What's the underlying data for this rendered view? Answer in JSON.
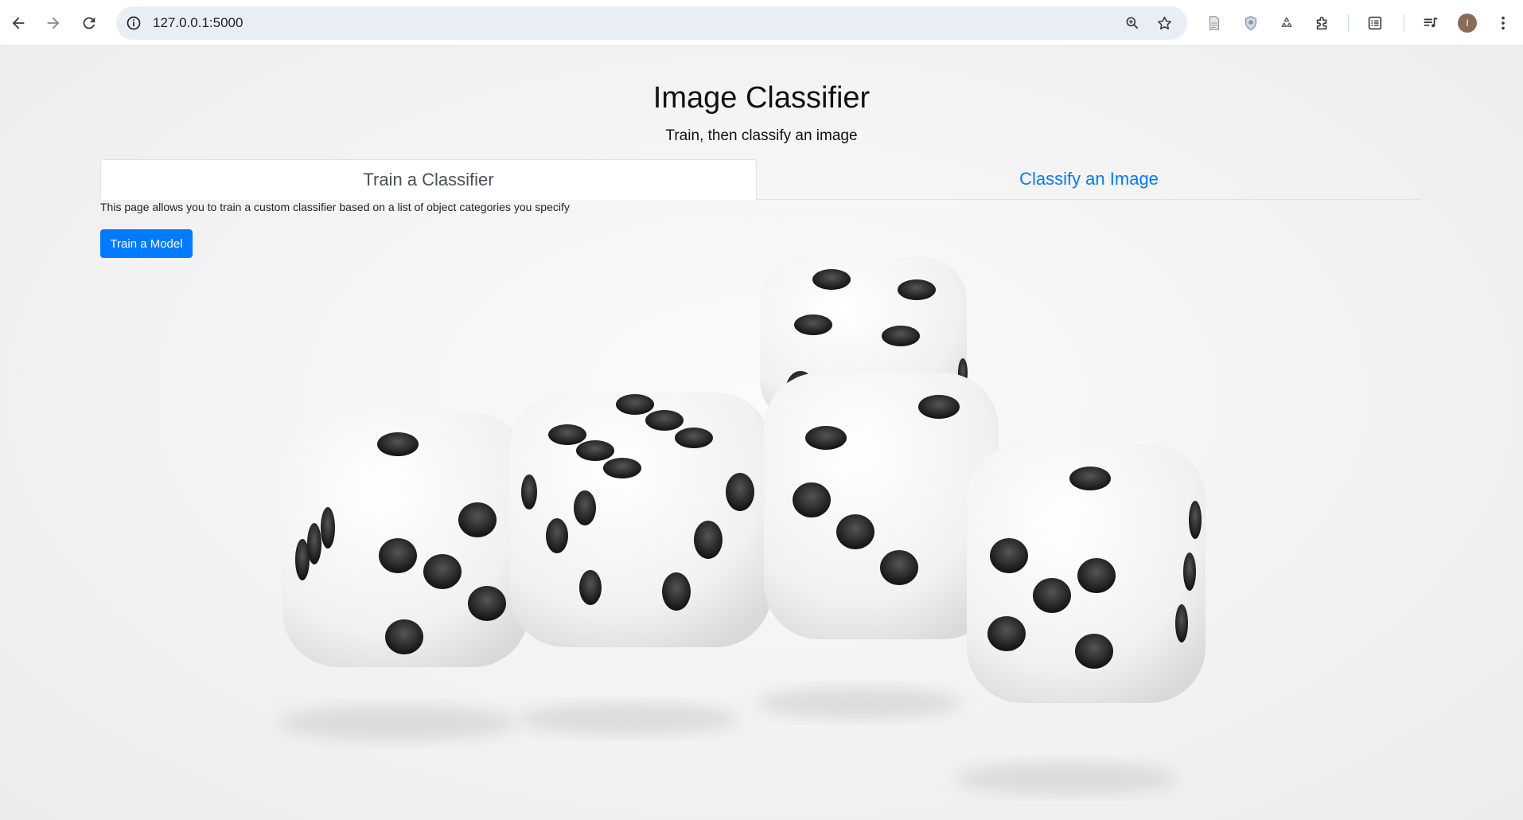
{
  "browser": {
    "url": "127.0.0.1:5000",
    "avatar_letter": "I",
    "icons": [
      "back-icon",
      "forward-icon",
      "reload-icon",
      "site-info-icon",
      "zoom-icon",
      "bookmark-star-icon",
      "document-icon",
      "shield-extension-icon",
      "recycle-extension-icon",
      "extensions-puzzle-icon",
      "reading-list-icon",
      "media-queue-icon",
      "menu-kebab-icon"
    ]
  },
  "page": {
    "title": "Image Classifier",
    "subtitle": "Train, then classify an image",
    "tabs": [
      {
        "label": "Train a Classifier",
        "active": true
      },
      {
        "label": "Classify an Image",
        "active": false
      }
    ],
    "description": "This page allows you to train a custom classifier based on a list of object categories you specify",
    "train_button_label": "Train a Model",
    "hero_image": "dice-photo",
    "colors": {
      "primary": "#007bff",
      "tab_active_text": "#495057"
    }
  }
}
